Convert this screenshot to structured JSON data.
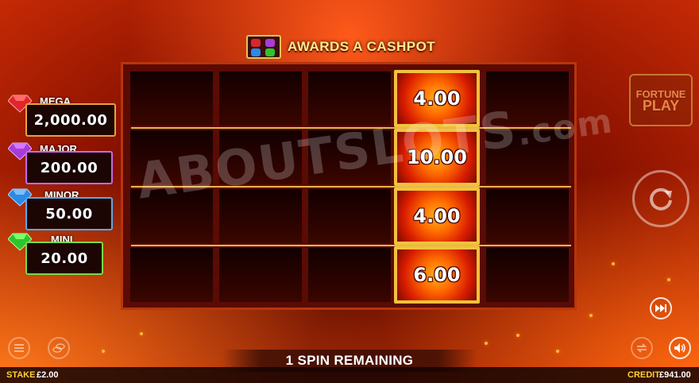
{
  "header": {
    "title": "AWARDS A CASHPOT",
    "icon": "four-gems-icon"
  },
  "jackpots": [
    {
      "name": "MEGA",
      "value": "2,000.00",
      "color": "#d8262a"
    },
    {
      "name": "MAJOR",
      "value": "200.00",
      "color": "#a83cd8"
    },
    {
      "name": "MINOR",
      "value": "50.00",
      "color": "#2a8ae6"
    },
    {
      "name": "MINI",
      "value": "20.00",
      "color": "#2ec52a"
    }
  ],
  "grid": {
    "columns": 5,
    "rows": 4,
    "prizes": [
      {
        "row": 1,
        "col": 4,
        "value": "4.00"
      },
      {
        "row": 2,
        "col": 4,
        "value": "10.00"
      },
      {
        "row": 3,
        "col": 4,
        "value": "4.00"
      },
      {
        "row": 4,
        "col": 4,
        "value": "6.00"
      }
    ]
  },
  "side": {
    "logo_line1": "FORTUNE",
    "logo_line2": "PLAY"
  },
  "status": {
    "spins_remaining": "1 SPIN REMAINING"
  },
  "footer": {
    "stake_label": "STAKE",
    "stake_value": "£2.00",
    "credit_label": "CREDIT",
    "credit_value": "£941.00"
  },
  "watermark": {
    "main": "ABOUTSLOTS",
    "suffix": ".com"
  },
  "colors": {
    "frame_gold": "#f2c23c",
    "accent_yellow": "#ffd13a"
  }
}
